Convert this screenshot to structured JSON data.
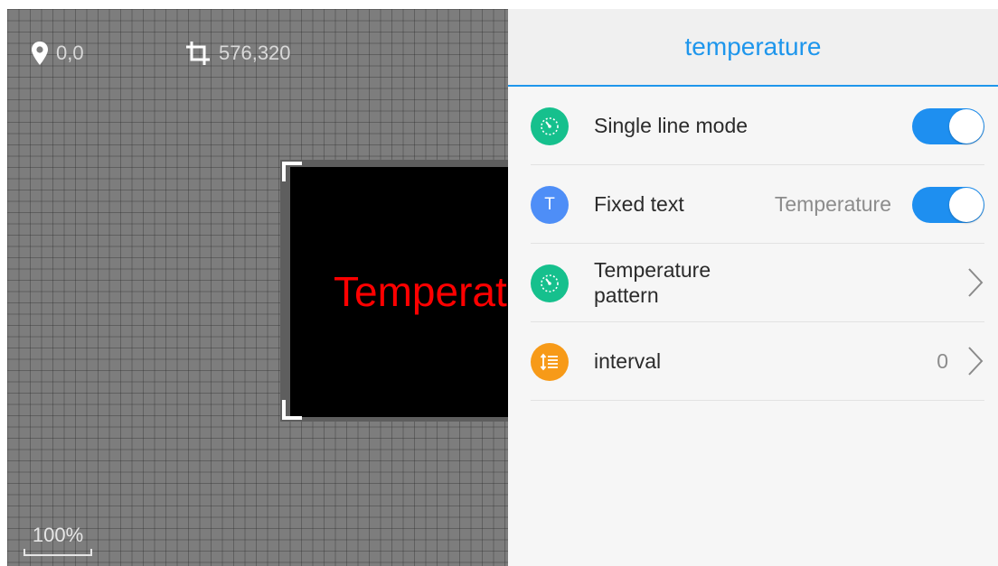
{
  "canvas": {
    "position_readout": "0,0",
    "size_readout": "576,320",
    "zoom_label": "100%",
    "screen_text": "Temperature",
    "screen_text_color": "#ff0000",
    "screen_background": "#000000",
    "grid_background": "#7d7d7d"
  },
  "panel": {
    "title": "temperature",
    "accent_color": "#1e96ec",
    "rows": [
      {
        "label": "Single line mode",
        "icon": "gauge-icon",
        "icon_color": "#16c08d",
        "control": "toggle",
        "on": true
      },
      {
        "label": "Fixed text",
        "icon_text": "T",
        "icon_color": "#4e8ef7",
        "value": "Temperature",
        "control": "toggle",
        "on": true
      },
      {
        "label": "Temperature pattern",
        "icon": "gauge-icon",
        "icon_color": "#16c08d",
        "control": "chevron"
      },
      {
        "label": "interval",
        "icon": "line-spacing-icon",
        "icon_color": "#f79a18",
        "value": "0",
        "control": "chevron"
      }
    ]
  }
}
